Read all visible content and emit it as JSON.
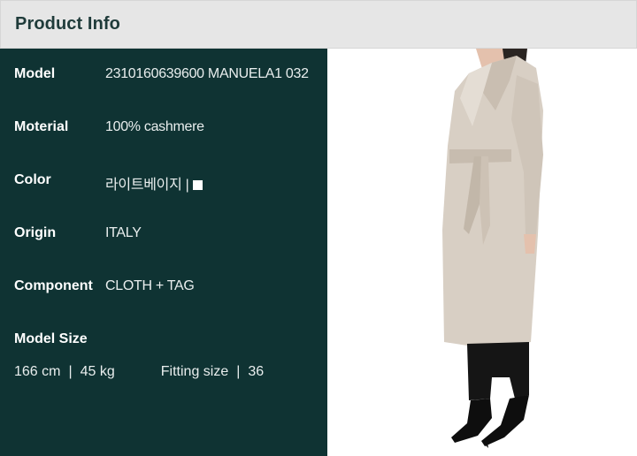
{
  "header": {
    "title": "Product Info"
  },
  "info": [
    {
      "label": "Model",
      "value": "2310160639600 MANUELA1 032"
    },
    {
      "label": "Moterial",
      "value": "100% cashmere"
    },
    {
      "label": "Color",
      "value": "라이트베이지 |"
    },
    {
      "label": "Origin",
      "value": "ITALY"
    },
    {
      "label": "Component",
      "value": "CLOTH + TAG"
    }
  ],
  "model_size": {
    "label": "Model Size",
    "height": "166 cm",
    "weight": "45 kg",
    "fitting_label": "Fitting size",
    "fitting_value": "36",
    "separator": "|"
  },
  "colors": {
    "panel_bg": "#0f3333",
    "header_bg": "#e6e6e6",
    "coat": "#d8cfc4",
    "swatch": "#ffffff"
  },
  "photo": {
    "description_icon": "model-photo"
  }
}
